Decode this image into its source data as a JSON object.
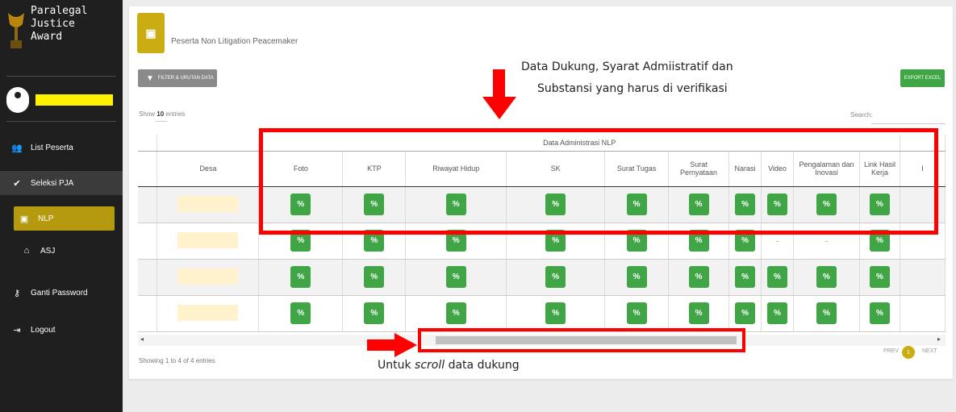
{
  "sidebar": {
    "brand": "Paralegal Justice Award",
    "brand_lines": [
      "Paralegal",
      "Justice",
      "Award"
    ],
    "menu": [
      {
        "icon": "users-icon",
        "glyph": "👥",
        "label": "List Peserta"
      },
      {
        "icon": "check-icon",
        "glyph": "✔",
        "label": "Seleksi PJA"
      },
      {
        "icon": "id-card-icon",
        "glyph": "▣",
        "label": "NLP"
      },
      {
        "icon": "home-icon",
        "glyph": "⌂",
        "label": "ASJ"
      },
      {
        "icon": "key-icon",
        "glyph": "⚷",
        "label": "Ganti Password"
      },
      {
        "icon": "logout-icon",
        "glyph": "⇥",
        "label": "Logout"
      }
    ]
  },
  "header": {
    "title": "Peserta Non Litigation Peacemaker"
  },
  "toolbar": {
    "filter_label": "FILTER & URUTAN DATA",
    "export_label": "EXPORT EXCEL"
  },
  "table_controls": {
    "show_prefix": "Show",
    "show_value": "10",
    "show_suffix": "entries",
    "search_label": "Search:"
  },
  "table": {
    "group_header": "Data Administrasi NLP",
    "columns": [
      "Desa",
      "Foto",
      "KTP",
      "Riwayat Hidup",
      "SK",
      "Surat Tugas",
      "Surat Pernyataan",
      "Narasi",
      "Video",
      "Pengalaman dan Inovasi",
      "Link Hasil Kerja"
    ],
    "rows": [
      [
        "link",
        "link",
        "link",
        "link",
        "link",
        "link",
        "link",
        "link",
        "link",
        "link"
      ],
      [
        "link",
        "link",
        "link",
        "link",
        "link",
        "link",
        "link",
        "-",
        "-",
        "link"
      ],
      [
        "link",
        "link",
        "link",
        "link",
        "link",
        "link",
        "link",
        "link",
        "link",
        "link"
      ],
      [
        "link",
        "link",
        "link",
        "link",
        "link",
        "link",
        "link",
        "link",
        "link",
        "link"
      ]
    ]
  },
  "footer": {
    "showing": "Showing 1 to 4 of 4 entries",
    "prev": "PREV",
    "page": "1",
    "next": "NEXT"
  },
  "annotations": {
    "top_line1": "Data Dukung, Syarat Admiistratif dan",
    "top_line2": "Substansi yang harus di verifikasi",
    "bottom_pre": "Untuk ",
    "bottom_em": "scroll",
    "bottom_post": " data dukung"
  },
  "colors": {
    "sidebar": "#1f1f1f",
    "accent": "#c9ad13",
    "button_green": "#3fa545",
    "highlight_red": "#ff0000"
  }
}
